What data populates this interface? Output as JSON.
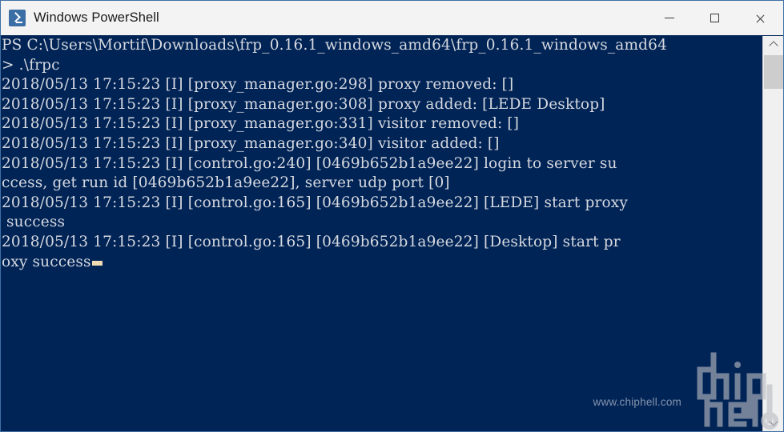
{
  "window": {
    "title": "Windows PowerShell",
    "app_icon": "powershell-prompt-icon",
    "accent_color": "#012456",
    "titlebar_color": "#f3f3f3",
    "text_color": "#d6d9e0",
    "cursor_color": "#efdcb5",
    "controls": {
      "minimize_label": "—",
      "maximize_label": "☐",
      "close_label": "✕"
    }
  },
  "console": {
    "lines": [
      "PS C:\\Users\\Mortif\\Downloads\\frp_0.16.1_windows_amd64\\frp_0.16.1_windows_amd64",
      "> .\\frpc",
      "2018/05/13 17:15:23 [I] [proxy_manager.go:298] proxy removed: []",
      "2018/05/13 17:15:23 [I] [proxy_manager.go:308] proxy added: [LEDE Desktop]",
      "2018/05/13 17:15:23 [I] [proxy_manager.go:331] visitor removed: []",
      "2018/05/13 17:15:23 [I] [proxy_manager.go:340] visitor added: []",
      "2018/05/13 17:15:23 [I] [control.go:240] [0469b652b1a9ee22] login to server su",
      "ccess, get run id [0469b652b1a9ee22], server udp port [0]",
      "2018/05/13 17:15:23 [I] [control.go:165] [0469b652b1a9ee22] [LEDE] start proxy",
      " success",
      "2018/05/13 17:15:23 [I] [control.go:165] [0469b652b1a9ee22] [Desktop] start pr",
      "oxy success"
    ],
    "cursor_visible": true,
    "cursor_line_index": 11
  },
  "scrollbar": {
    "up_arrow": "chevron-up-icon",
    "down_arrow": "chevron-down-icon",
    "thumb_position_percent": 5
  },
  "watermark": {
    "site": "www.chiphell.com",
    "logo_text": "chiphell"
  }
}
